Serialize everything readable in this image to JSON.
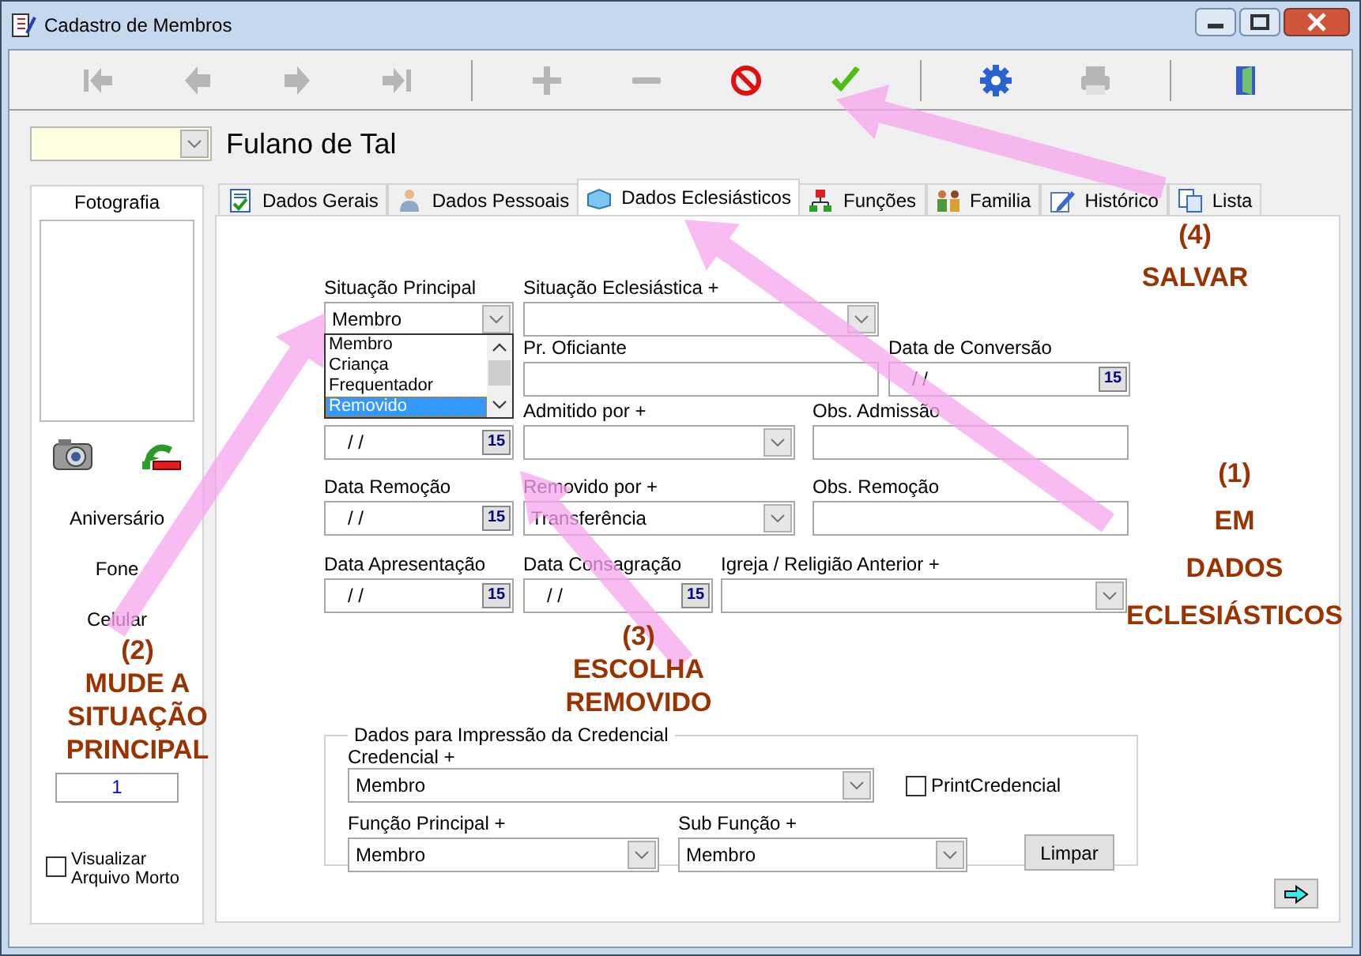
{
  "window": {
    "title": "Cadastro de Membros"
  },
  "toolbar": [
    {
      "kind": "first",
      "disabled": true
    },
    {
      "kind": "prev",
      "disabled": true
    },
    {
      "kind": "next",
      "disabled": true
    },
    {
      "kind": "last",
      "disabled": true
    },
    {
      "kind": "separator"
    },
    {
      "kind": "add",
      "disabled": true
    },
    {
      "kind": "remove",
      "disabled": true
    },
    {
      "kind": "cancel",
      "disabled": false
    },
    {
      "kind": "save",
      "disabled": false
    },
    {
      "kind": "separator"
    },
    {
      "kind": "settings",
      "disabled": false
    },
    {
      "kind": "print",
      "disabled": true
    },
    {
      "kind": "separator"
    },
    {
      "kind": "exit",
      "disabled": false
    }
  ],
  "member": {
    "name": "Fulano de Tal"
  },
  "left_panel": {
    "photo_label": "Fotografia",
    "labels": [
      "Aniversário",
      "Fone",
      "Celular"
    ],
    "field_value": "1",
    "archive_checkbox": {
      "label": "Visualizar Arquivo Morto",
      "checked": false
    }
  },
  "tabs": [
    {
      "label": "Dados Gerais",
      "kind": "general",
      "selected": false
    },
    {
      "label": "Dados Pessoais",
      "kind": "personal",
      "selected": false
    },
    {
      "label": "Dados Eclesiásticos",
      "kind": "church",
      "selected": true
    },
    {
      "label": "Funções",
      "kind": "roles",
      "selected": false
    },
    {
      "label": "Familia",
      "kind": "family",
      "selected": false
    },
    {
      "label": "Histórico",
      "kind": "history",
      "selected": false
    },
    {
      "label": "Lista",
      "kind": "list",
      "selected": false
    }
  ],
  "form_rows": [
    [
      {
        "label": "Situação Principal",
        "kind": "combo",
        "value": "Membro"
      },
      {
        "label": "Situação Eclesiástica +",
        "kind": "combo"
      }
    ],
    [
      {
        "label": "Pr. Oficiante",
        "kind": "text"
      },
      {
        "label": "Data de Conversão",
        "kind": "date",
        "value": "/ /",
        "calendar": "15"
      }
    ],
    [
      {
        "kind": "date",
        "value": "/ /",
        "calendar": "15"
      },
      {
        "label": "Admitido por +",
        "kind": "combo"
      },
      {
        "label": "Obs. Admissão",
        "kind": "text"
      }
    ],
    [
      {
        "label": "Data Remoção",
        "kind": "date",
        "value": "/ /",
        "calendar": "15"
      },
      {
        "label": "Removido por +",
        "kind": "combo",
        "value": "Transferência"
      },
      {
        "label": "Obs. Remoção",
        "kind": "text"
      }
    ],
    [
      {
        "label": "Data Apresentação",
        "kind": "date",
        "value": "/ /",
        "calendar": "15"
      },
      {
        "label": "Data Consagração",
        "kind": "date",
        "value": "/ /",
        "calendar": "15"
      },
      {
        "label": "Igreja / Religião Anterior +",
        "kind": "combo"
      }
    ]
  ],
  "dropdown": {
    "options": [
      {
        "label": "Membro",
        "selected": false
      },
      {
        "label": "Criança",
        "selected": false
      },
      {
        "label": "Frequentador",
        "selected": false
      },
      {
        "label": "Removido",
        "selected": true
      }
    ]
  },
  "credential_group": {
    "title": "Dados para Impressão da Credencial",
    "credential": {
      "label": "Credencial +",
      "value": "Membro"
    },
    "print_checkbox": {
      "label": "PrintCredencial",
      "checked": false
    },
    "main_function": {
      "label": "Função Principal +",
      "value": "Membro"
    },
    "sub_function": {
      "label": "Sub Função +",
      "value": "Membro"
    },
    "clear_button": "Limpar"
  },
  "annotations": [
    {
      "number": "(1)",
      "lines": [
        "EM",
        "DADOS",
        "ECLESIÁSTICOS"
      ]
    },
    {
      "number": "(2)",
      "lines": [
        "MUDE A",
        "SITUAÇÃO",
        "PRINCIPAL"
      ]
    },
    {
      "number": "(3)",
      "lines": [
        "ESCOLHA",
        "REMOVIDO"
      ]
    },
    {
      "number": "(4)",
      "lines": [
        "SALVAR"
      ]
    }
  ]
}
